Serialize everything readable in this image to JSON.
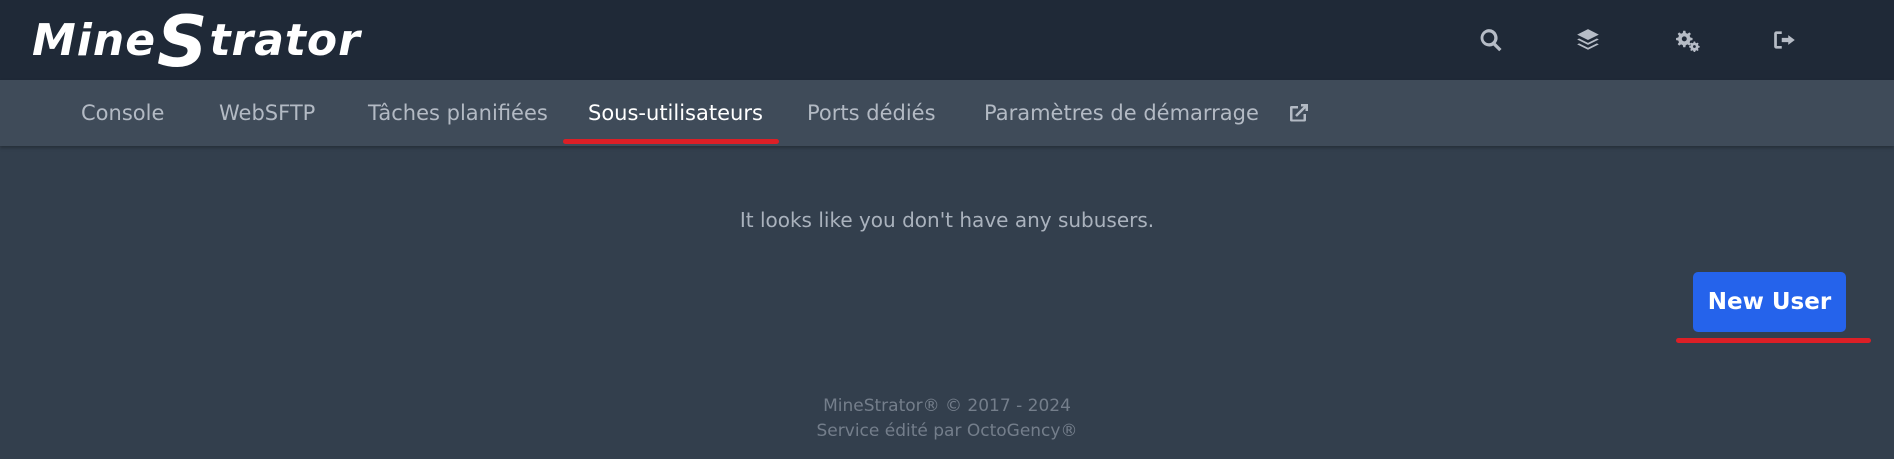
{
  "logo": {
    "part1": "Mine",
    "part2": "S",
    "part3": "trator"
  },
  "top_icons": [
    "search-icon",
    "layers-icon",
    "cogs-icon",
    "logout-icon"
  ],
  "tabs": [
    {
      "label": "Console"
    },
    {
      "label": "WebSFTP"
    },
    {
      "label": "Tâches planifiées"
    },
    {
      "label": "Sous-utilisateurs",
      "active": true
    },
    {
      "label": "Ports dédiés"
    },
    {
      "label": "Paramètres de démarrage"
    }
  ],
  "external_link_icon": "external-link-icon",
  "main": {
    "empty_message": "It looks like you don't have any subusers.",
    "new_user_label": "New User"
  },
  "footer": {
    "line1": "MineStrator® © 2017 - 2024",
    "line2": "Service édité par OctoGency®"
  },
  "colors": {
    "topbar": "#1f2937",
    "tabbar": "#3f4b59",
    "background": "#333f4d",
    "primary_button": "#2563eb",
    "highlight": "#dc1f26"
  }
}
